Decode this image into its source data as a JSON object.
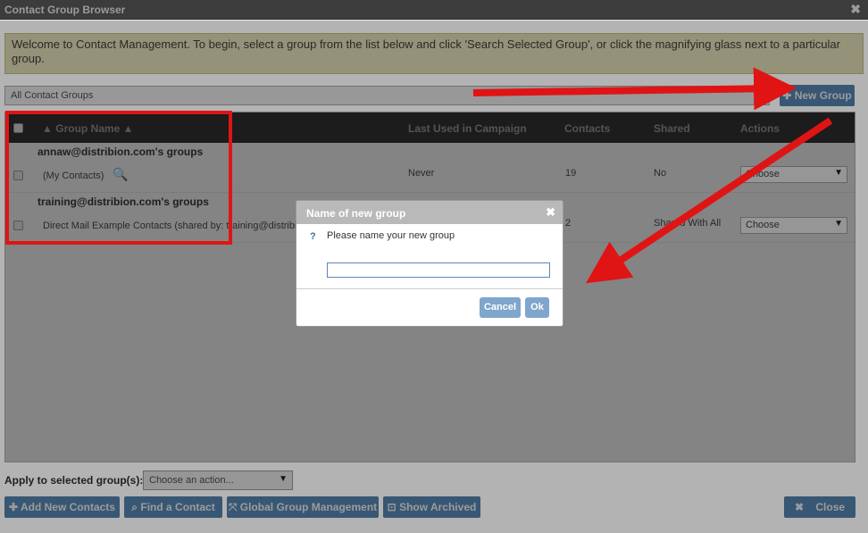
{
  "window": {
    "title": "Contact Group Browser",
    "close": "✖"
  },
  "welcome": "Welcome to Contact Management. To begin, select a group from the list below and click 'Search Selected Group', or click the magnifying glass next to a particular group.",
  "group_filter": {
    "value": "All Contact Groups"
  },
  "new_group_button": "New Group",
  "table": {
    "columns": [
      "Group Name",
      "Last Used in Campaign",
      "Contacts",
      "Shared",
      "Actions"
    ],
    "sort_indicator": "▲",
    "groups": [
      {
        "header": "annaw@distribion.com's groups",
        "rows": [
          {
            "name": "(My Contacts)",
            "last_used": "Never",
            "contacts": "19",
            "shared": "No",
            "action": "Choose"
          }
        ]
      },
      {
        "header": "training@distribion.com's groups",
        "rows": [
          {
            "name": "Direct Mail Example Contacts (shared by: training@distribi",
            "last_used": "",
            "contacts": "2",
            "shared": "Shared With All",
            "action": "Choose"
          }
        ]
      }
    ]
  },
  "dialog": {
    "title": "Name of new group",
    "message": "Please name your new group",
    "input_value": "",
    "cancel": "Cancel",
    "ok": "Ok",
    "close": "✖"
  },
  "footer": {
    "apply_label": "Apply to selected group(s):",
    "apply_select": "Choose an action...",
    "buttons": {
      "add": "Add New Contacts",
      "find": "Find a Contact",
      "global": "Global Group Management",
      "archived": "Show Archived",
      "close": "Close"
    }
  },
  "colors": {
    "annotation": "#e01414",
    "button": "#5c8fbf",
    "header": "#2f2f2f",
    "welcome_bg": "#f3f1c5"
  }
}
